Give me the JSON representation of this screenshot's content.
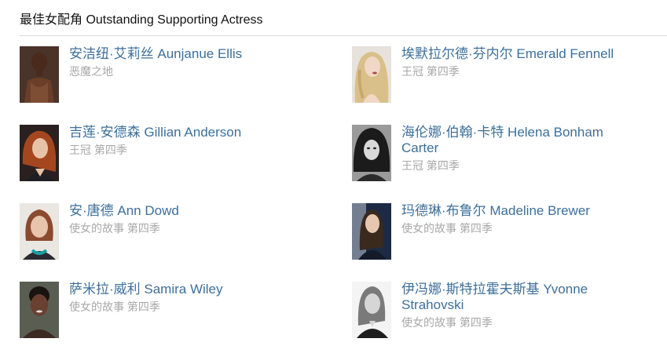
{
  "section": {
    "title": "最佳女配角 Outstanding Supporting Actress"
  },
  "nominees": [
    {
      "name": "安洁纽·艾莉丝 Aunjanue Ellis",
      "show": "恶魔之地",
      "photo_icon": "portrait-photo"
    },
    {
      "name": "埃默拉尔德·芬内尔 Emerald Fennell",
      "show": "王冠 第四季",
      "photo_icon": "portrait-photo"
    },
    {
      "name": "吉莲·安德森 Gillian Anderson",
      "show": "王冠 第四季",
      "photo_icon": "portrait-photo"
    },
    {
      "name": "海伦娜·伯翰·卡特 Helena Bonham Carter",
      "show": "王冠 第四季",
      "photo_icon": "portrait-photo"
    },
    {
      "name": "安·唐德 Ann Dowd",
      "show": "使女的故事 第四季",
      "photo_icon": "portrait-photo"
    },
    {
      "name": "玛德琳·布鲁尔 Madeline Brewer",
      "show": "使女的故事 第四季",
      "photo_icon": "portrait-photo"
    },
    {
      "name": "萨米拉·威利 Samira Wiley",
      "show": "使女的故事 第四季",
      "photo_icon": "portrait-photo"
    },
    {
      "name": "伊冯娜·斯特拉霍夫斯基 Yvonne Strahovski",
      "show": "使女的故事 第四季",
      "photo_icon": "portrait-photo"
    }
  ],
  "colors": {
    "name_link": "#3d6f9a",
    "show_text": "#a8a8a8",
    "divider": "#d9d9d9"
  }
}
